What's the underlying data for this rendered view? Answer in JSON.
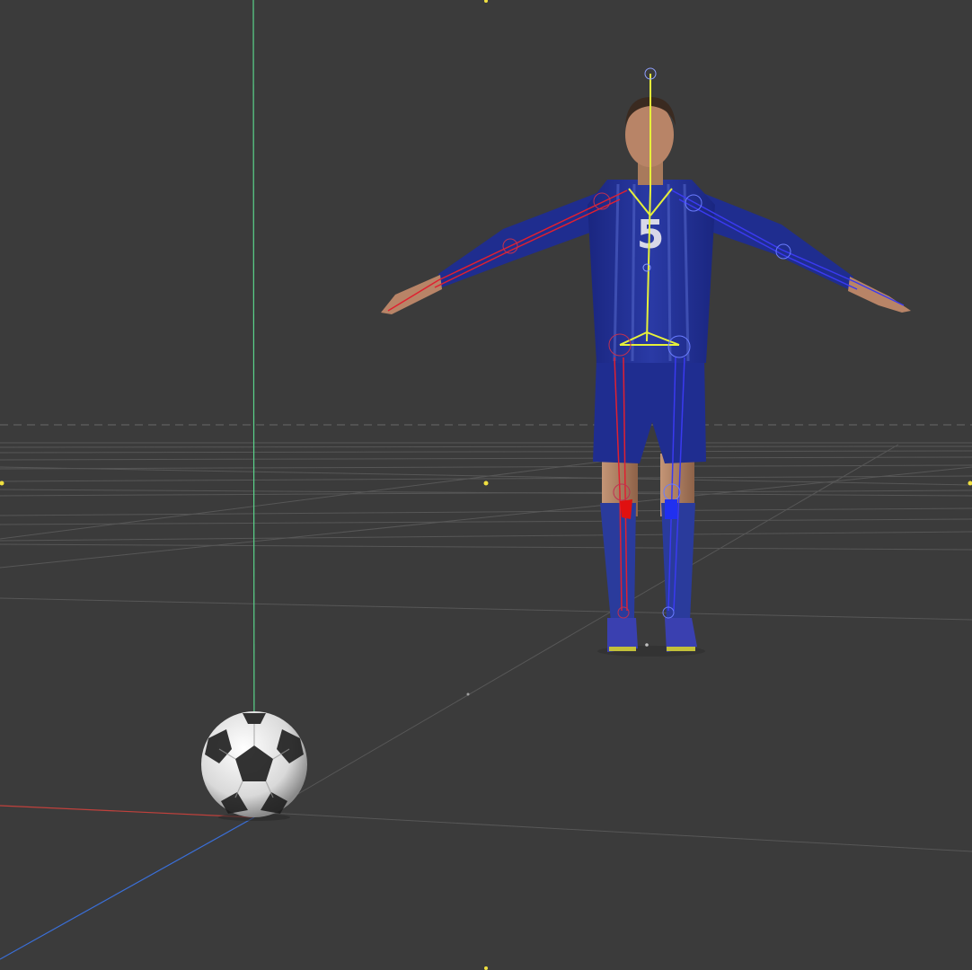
{
  "viewport": {
    "background_color": "#3b3b3b",
    "grid_color": "#5a5a5a",
    "axis_colors": {
      "x": "#c0413c",
      "y": "#5ad38a",
      "z": "#3a6fd8"
    },
    "marker_color": "#f0e040"
  },
  "character": {
    "jersey_number": "5",
    "jersey_color": "#1f2d8f",
    "shorts_color": "#1e2c8c",
    "sock_color": "#253590",
    "skin_color": "#b98a6a",
    "rig": {
      "spine_color": "#e6f03a",
      "left_side_color": "#e02030",
      "right_side_color": "#3a3af0",
      "joint_color": "#6a7cff"
    }
  },
  "ball": {
    "icon": "soccer-ball-icon",
    "primary_color": "#f2f2f2",
    "panel_color": "#222222"
  }
}
